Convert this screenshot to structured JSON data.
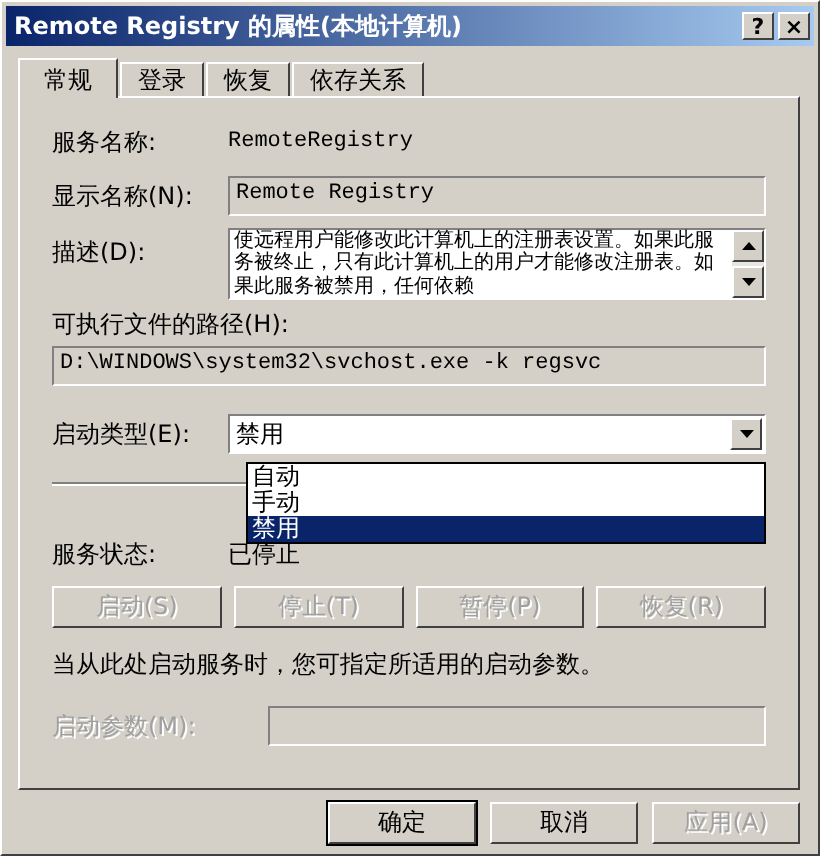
{
  "window": {
    "title": "Remote Registry 的属性(本地计算机)",
    "buttons": [
      "?",
      "×"
    ]
  },
  "tabs": [
    {
      "label": "常规",
      "selected": true
    },
    {
      "label": "登录",
      "selected": false
    },
    {
      "label": "恢复",
      "selected": false
    },
    {
      "label": "依存关系",
      "selected": false
    }
  ],
  "service_name": {
    "label": "服务名称:",
    "value": "RemoteRegistry"
  },
  "display_name": {
    "label": "显示名称(N):",
    "value": "Remote Registry"
  },
  "description": {
    "label": "描述(D):",
    "value": "使远程用户能修改此计算机上的注册表设置。如果此服务被终止，只有此计算机上的用户才能修改注册表。如果此服务被禁用，任何依赖"
  },
  "path": {
    "label": "可执行文件的路径(H):",
    "value": "D:\\WINDOWS\\system32\\svchost.exe -k regsvc"
  },
  "startup_type": {
    "label": "启动类型(E):",
    "value": "禁用",
    "expanded": true,
    "options": [
      {
        "label": "自动",
        "selected": false
      },
      {
        "label": "手动",
        "selected": false
      },
      {
        "label": "禁用",
        "selected": true
      }
    ]
  },
  "service_status": {
    "label": "服务状态:",
    "value": "已停止"
  },
  "control_buttons": [
    {
      "label": "启动(S)",
      "disabled": true
    },
    {
      "label": "停止(T)",
      "disabled": true
    },
    {
      "label": "暂停(P)",
      "disabled": true
    },
    {
      "label": "恢复(R)",
      "disabled": true
    }
  ],
  "hint": "当从此处启动服务时，您可指定所适用的启动参数。",
  "start_params": {
    "label": "启动参数(M):",
    "disabled": true
  },
  "footer_buttons": [
    {
      "label": "确定",
      "disabled": false,
      "default": true
    },
    {
      "label": "取消",
      "disabled": false,
      "default": false
    },
    {
      "label": "应用(A)",
      "disabled": true,
      "default": false
    }
  ]
}
